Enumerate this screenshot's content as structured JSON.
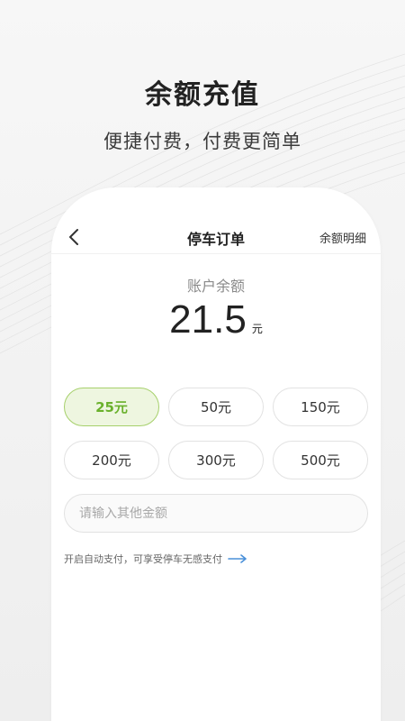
{
  "promo": {
    "title": "余额充值",
    "subtitle": "便捷付费，付费更简单"
  },
  "nav": {
    "back_icon": "chevron-left-icon",
    "title": "停车订单",
    "right_link": "余额明细"
  },
  "balance": {
    "label": "账户余额",
    "amount": "21.5",
    "unit": "元"
  },
  "amounts": [
    {
      "label": "25元",
      "selected": true
    },
    {
      "label": "50元",
      "selected": false
    },
    {
      "label": "150元",
      "selected": false
    },
    {
      "label": "200元",
      "selected": false
    },
    {
      "label": "300元",
      "selected": false
    },
    {
      "label": "500元",
      "selected": false
    }
  ],
  "other_amount": {
    "placeholder": "请输入其他金额",
    "value": ""
  },
  "autopay": {
    "text": "开启自动支付，可享受停车无感支付",
    "icon": "arrow-right-icon"
  },
  "colors": {
    "accent": "#6ab12c",
    "accent_bg": "#eef6e0",
    "arrow": "#4a90d9"
  }
}
